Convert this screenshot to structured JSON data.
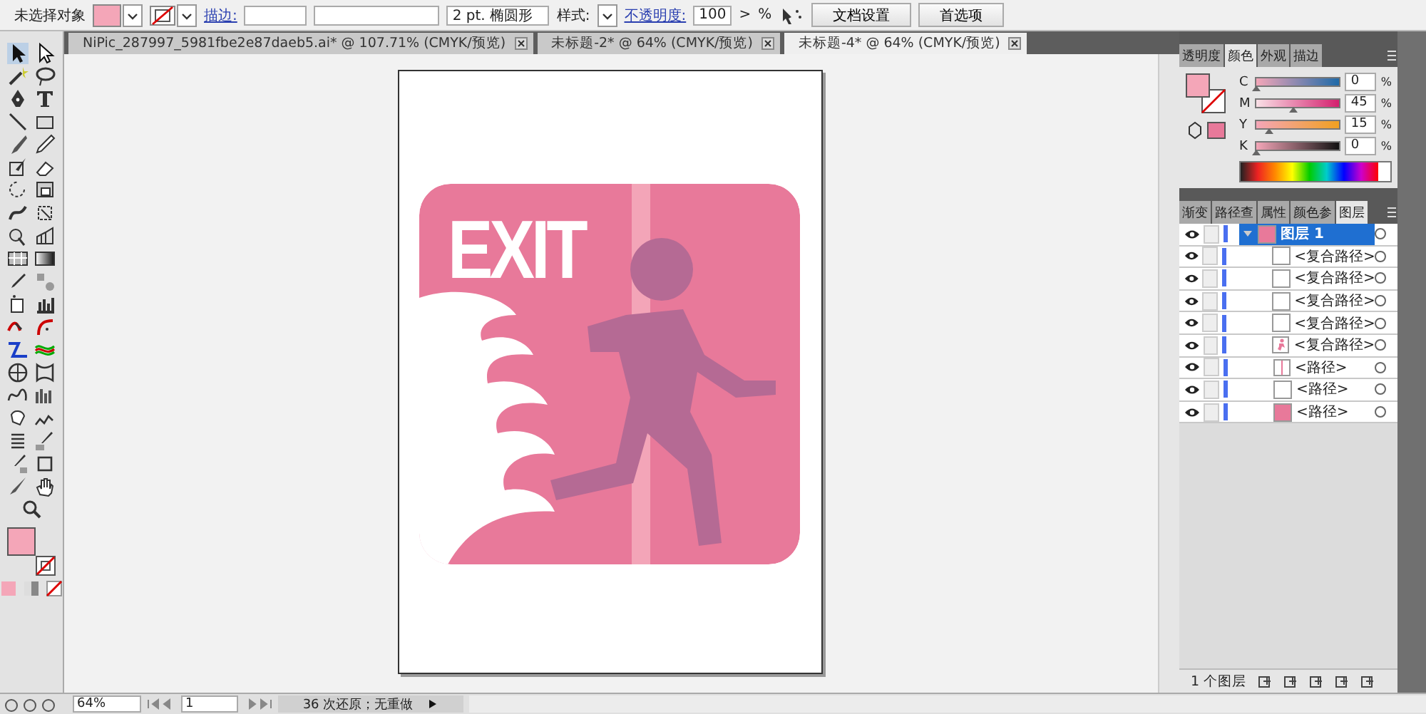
{
  "control_bar": {
    "selection_label": "未选择对象",
    "stroke_label": "描边:",
    "brush": "2 pt. 椭圆形",
    "style_label": "样式:",
    "opacity_label": "不透明度:",
    "opacity_value": "100",
    "opacity_arrow": ">",
    "opacity_unit": "%",
    "buttons": [
      "文档设置",
      "首选项"
    ]
  },
  "document_tabs": [
    {
      "label": "NiPic_287997_5981fbe2e87daeb5.ai* @ 107.71% (CMYK/预览)",
      "selected": false
    },
    {
      "label": "未标题-2* @ 64% (CMYK/预览)",
      "selected": false
    },
    {
      "label": "未标题-4* @ 64% (CMYK/预览)",
      "selected": true
    }
  ],
  "artwork": {
    "sign_text": "EXIT"
  },
  "color_panel": {
    "tabs": [
      {
        "label": "透明度",
        "selected": false
      },
      {
        "label": "颜色",
        "selected": true
      },
      {
        "label": "外观",
        "selected": false
      },
      {
        "label": "描边",
        "selected": false
      }
    ],
    "channels": [
      {
        "name": "C",
        "value": "0",
        "unit": "%",
        "level": 0
      },
      {
        "name": "M",
        "value": "45",
        "unit": "%",
        "level": 0.45
      },
      {
        "name": "Y",
        "value": "15",
        "unit": "%",
        "level": 0.15
      },
      {
        "name": "K",
        "value": "0",
        "unit": "%",
        "level": 0
      }
    ]
  },
  "layers_panel": {
    "tabs": [
      {
        "label": "渐变",
        "selected": false
      },
      {
        "label": "路径查",
        "selected": false
      },
      {
        "label": "属性",
        "selected": false
      },
      {
        "label": "颜色参",
        "selected": false
      },
      {
        "label": "图层",
        "selected": true
      }
    ],
    "layers": [
      {
        "name": "图层 1",
        "kind": "layer",
        "selected": true,
        "expanded": true,
        "children": [
          {
            "name": "<复合路径>",
            "kind": "blank",
            "selected": false
          },
          {
            "name": "<复合路径>",
            "kind": "blank",
            "selected": false
          },
          {
            "name": "<复合路径>",
            "kind": "blank",
            "selected": false
          },
          {
            "name": "<复合路径>",
            "kind": "blank",
            "selected": false
          },
          {
            "name": "<复合路径>",
            "kind": "figure",
            "selected": false
          },
          {
            "name": "<路径>",
            "kind": "line",
            "selected": false
          },
          {
            "name": "<路径>",
            "kind": "blank",
            "selected": false
          },
          {
            "name": "<路径>",
            "kind": "fill",
            "selected": false
          }
        ]
      }
    ],
    "footer": "1 个图层"
  },
  "status_bar": {
    "zoom": "64%",
    "page": "1",
    "history": "36 次还原；无重做"
  }
}
